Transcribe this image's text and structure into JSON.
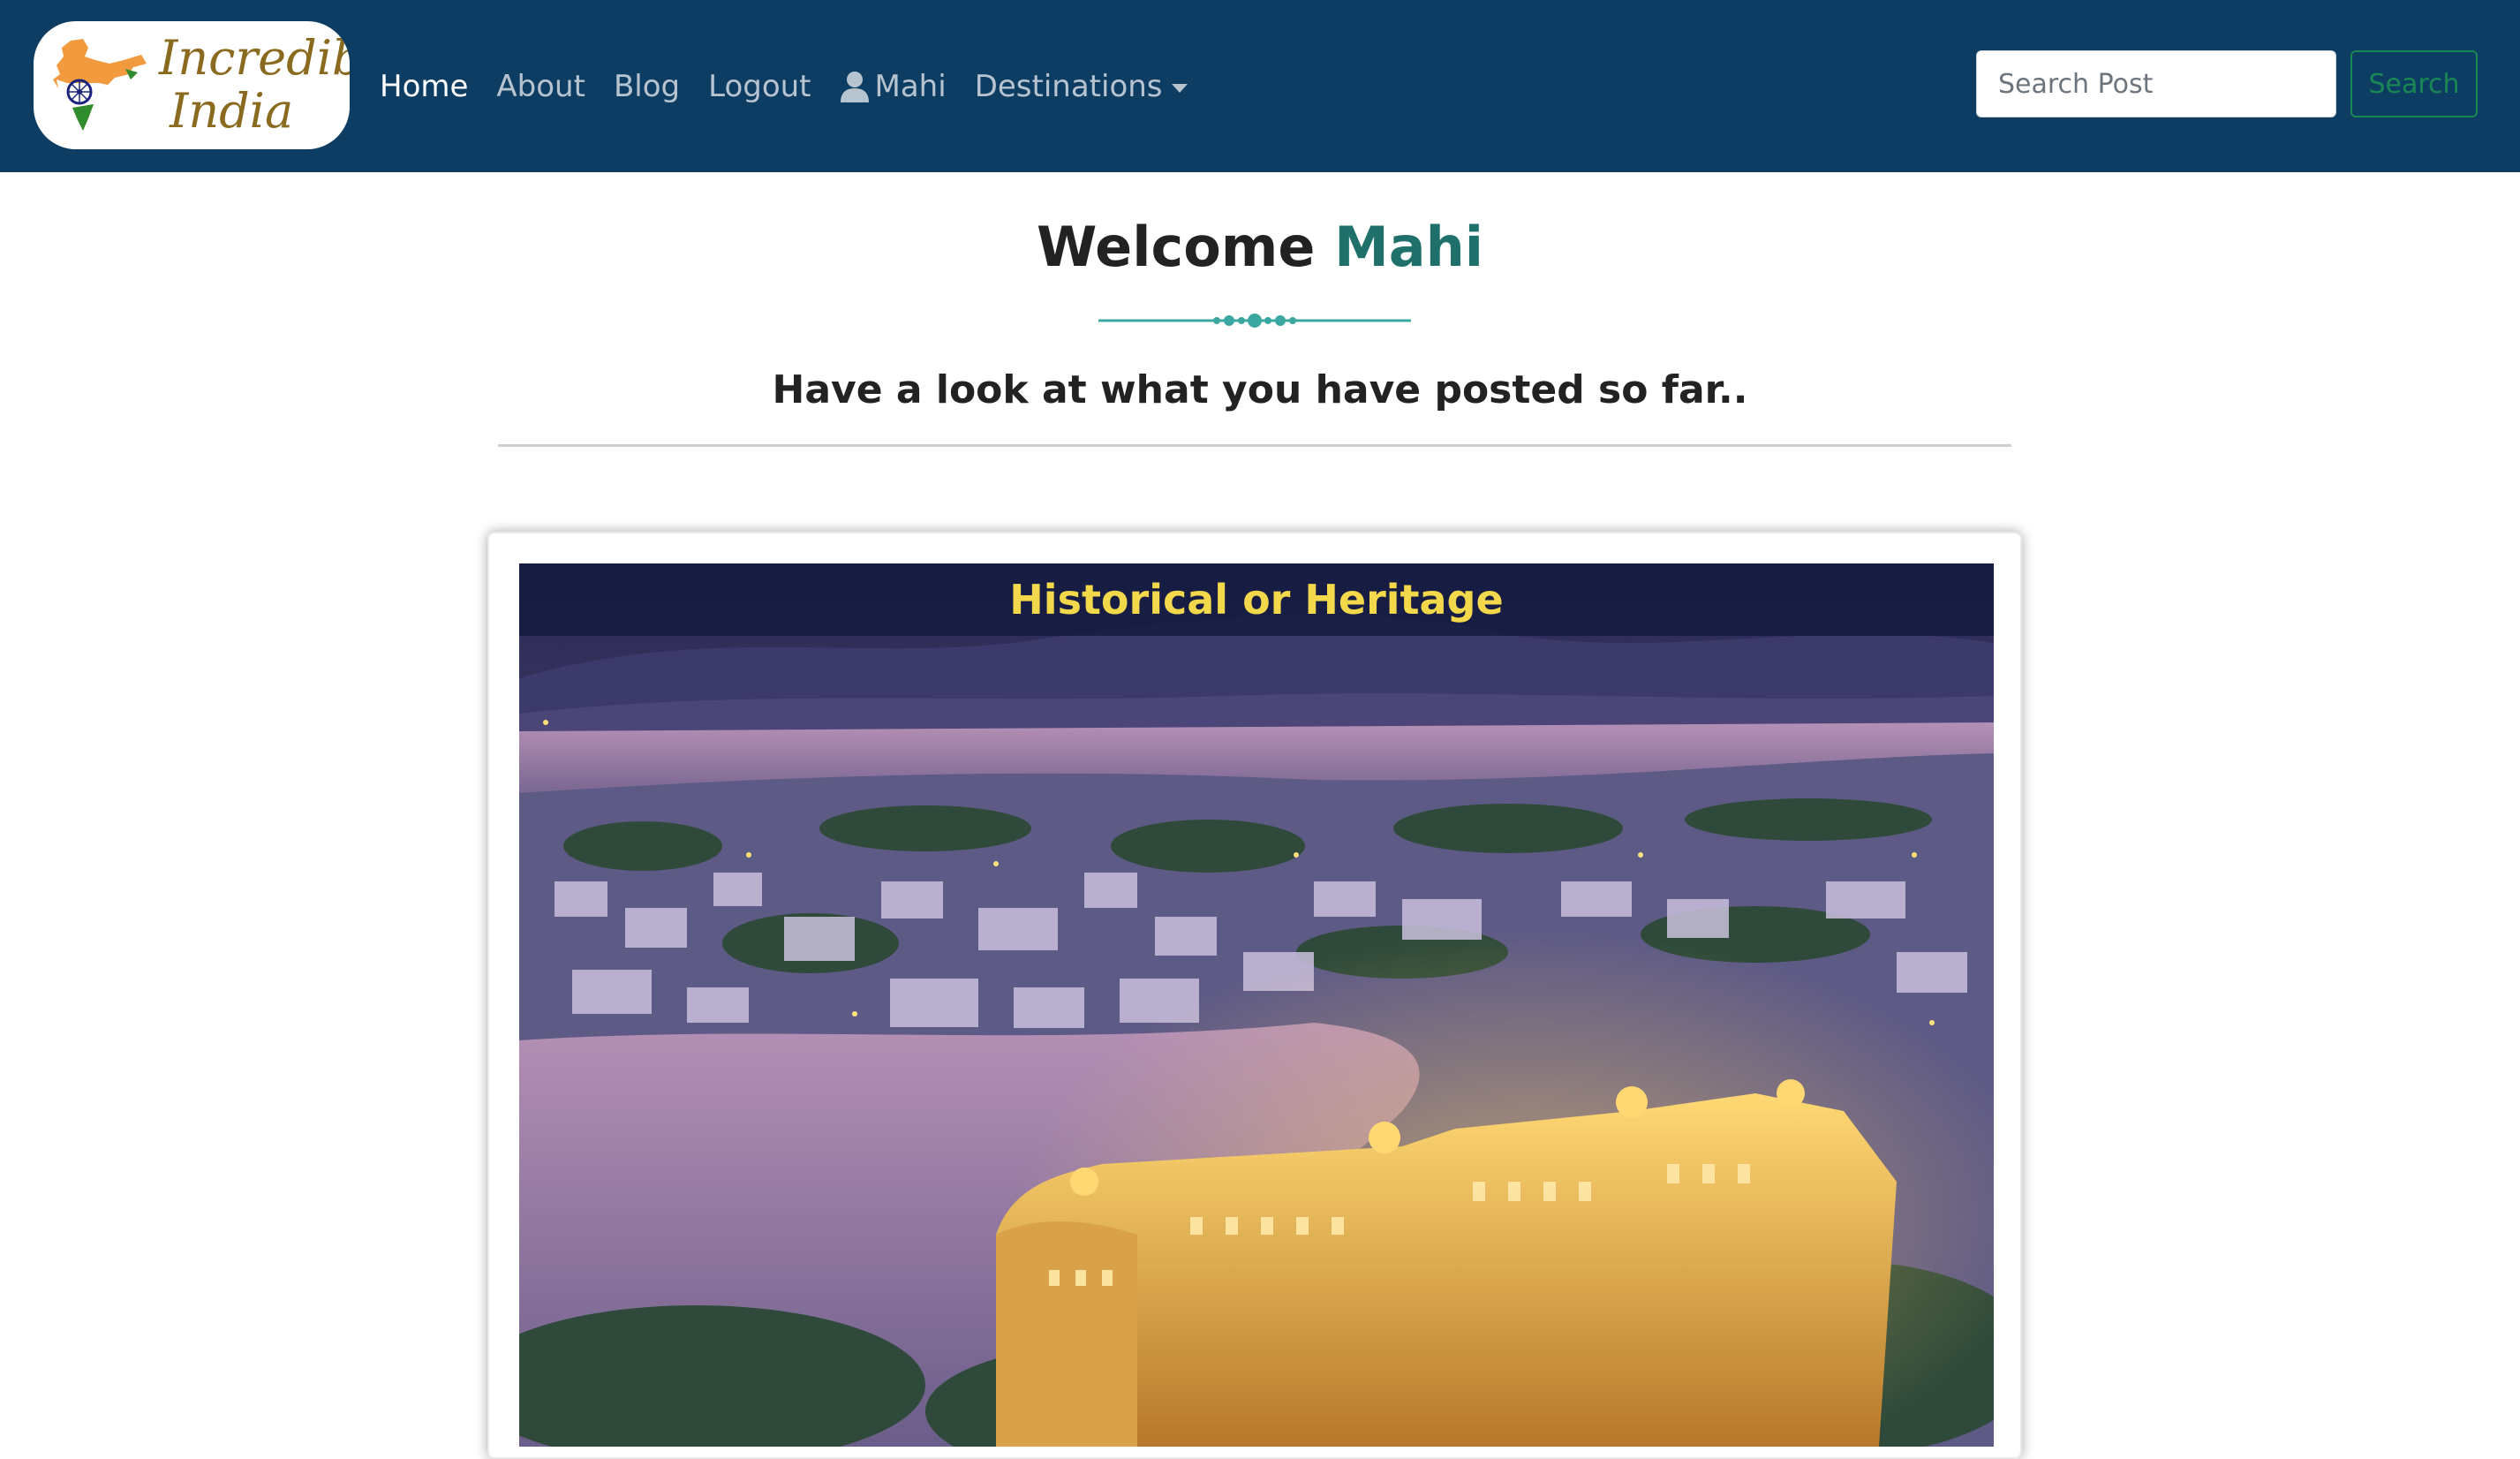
{
  "brand": {
    "line1": "Incredible",
    "line2": "India"
  },
  "nav": {
    "items": [
      {
        "label": "Home",
        "active": true
      },
      {
        "label": "About",
        "active": false
      },
      {
        "label": "Blog",
        "active": false
      },
      {
        "label": "Logout",
        "active": false
      },
      {
        "label": "Mahi",
        "active": false,
        "icon": "user-icon"
      },
      {
        "label": "Destinations",
        "active": false,
        "icon": "caret-down-icon"
      }
    ]
  },
  "search": {
    "placeholder": "Search Post",
    "button_label": "Search"
  },
  "main": {
    "welcome_prefix": "Welcome",
    "welcome_name": "Mahi",
    "subtitle": "Have a look at what you have posted so far.."
  },
  "post": {
    "category": "Historical or Heritage"
  },
  "colors": {
    "navbar_bg": "#0d3d63",
    "accent_teal": "#1f6f6b",
    "search_green": "#198754",
    "category_yellow": "#f2d84a"
  }
}
